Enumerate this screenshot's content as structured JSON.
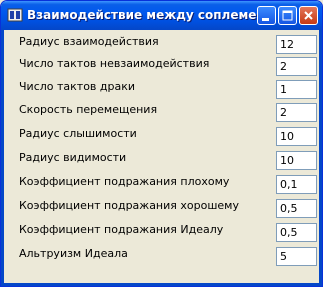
{
  "window": {
    "title": "Взаимодействие между соплеменник...",
    "accent": "#0055e5",
    "close_color": "#d7542c"
  },
  "fields": [
    {
      "label": "Радиус взаимодействия",
      "value": "12"
    },
    {
      "label": "Число тактов невзаимодействия",
      "value": "2"
    },
    {
      "label": "Число тактов драки",
      "value": "1"
    },
    {
      "label": "Скорость перемещения",
      "value": "2"
    },
    {
      "label": "Радиус слышимости",
      "value": "10"
    },
    {
      "label": "Радиус видимости",
      "value": "10"
    },
    {
      "label": "Коэффициент подражания плохому",
      "value": "0,1"
    },
    {
      "label": "Коэффициент подражания хорошему",
      "value": "0,5"
    },
    {
      "label": "Коэффициент подражания Идеалу",
      "value": "0,5"
    },
    {
      "label": "Альтруизм Идеала",
      "value": "5"
    }
  ]
}
